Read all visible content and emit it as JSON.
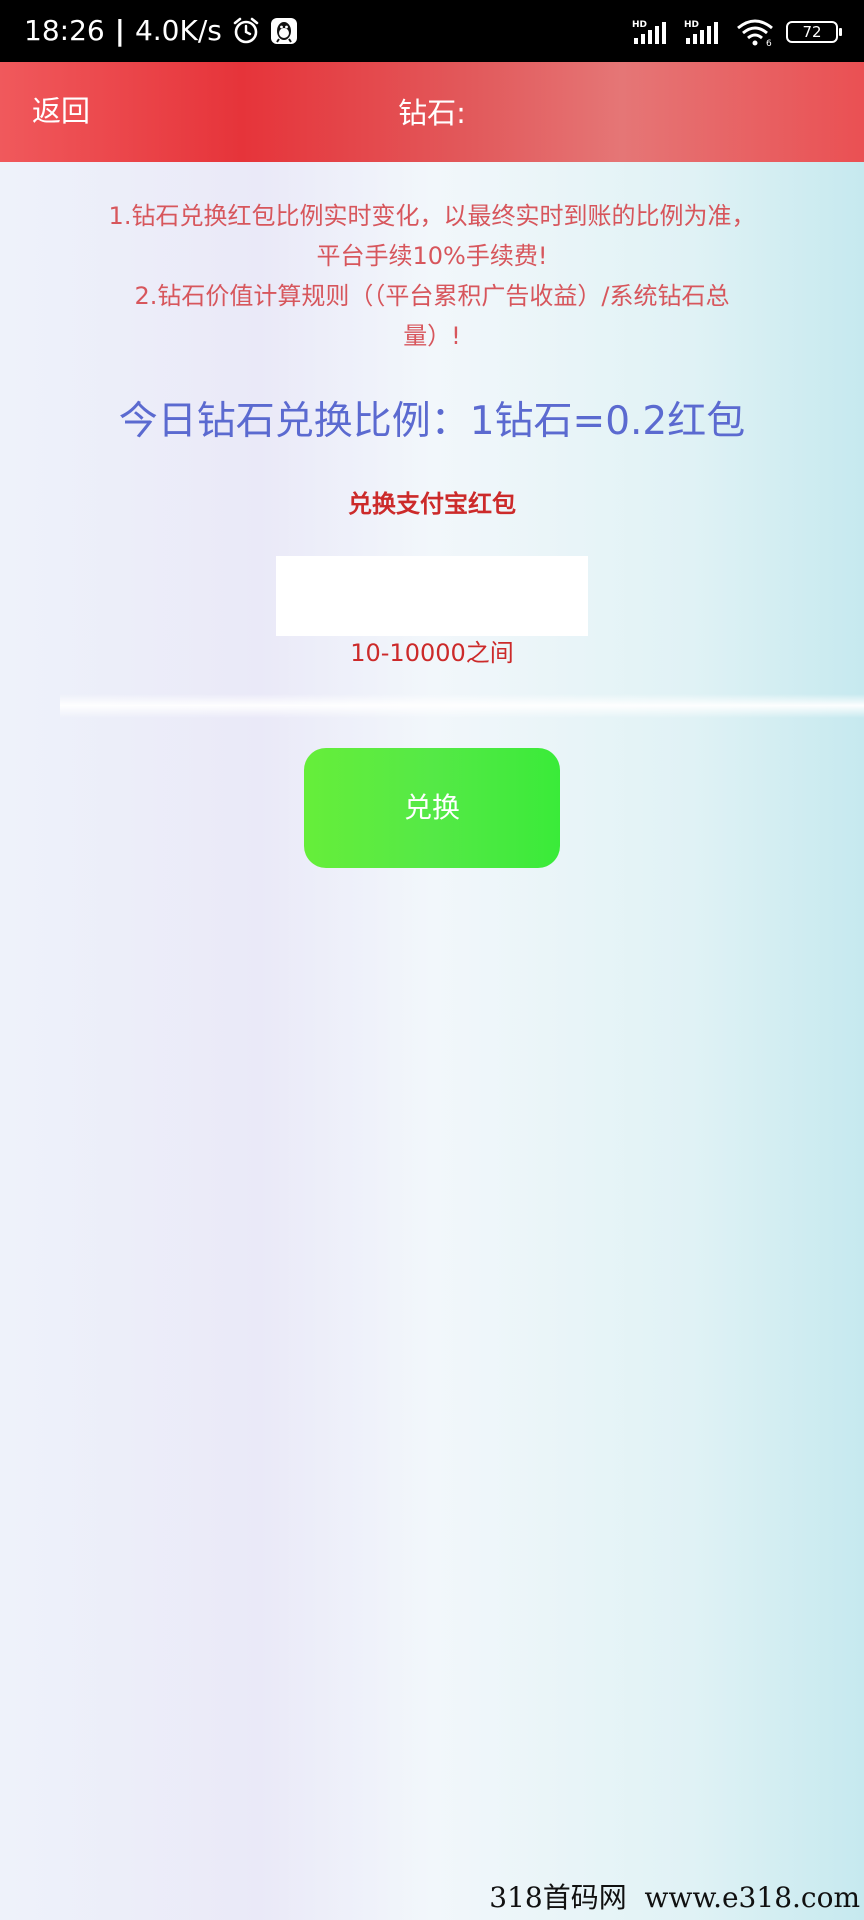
{
  "status_bar": {
    "time": "18:26",
    "separator": "|",
    "network_speed": "4.0K/s",
    "left_icons": [
      "alarm-icon",
      "qq-icon"
    ],
    "right_icons": [
      "hd-signal-icon",
      "hd-signal-icon",
      "wifi-icon"
    ],
    "signal_label_1": "HD",
    "signal_label_2": "HD",
    "wifi_label": "6",
    "battery": "72"
  },
  "nav": {
    "back_label": "返回",
    "title": "钻石:",
    "color": "#e6343a"
  },
  "notice": {
    "line1": "1.钻石兑换红包比例实时变化，以最终实时到账的比例为准，",
    "line2": "平台手续10%手续费!",
    "line3": "2.钻石价值计算规则（（平台累积广告收益）/系统钻石总",
    "line4": "量）!"
  },
  "rate_text": "今日钻石兑换比例：1钻石=0.2红包",
  "exchange_label": "兑换支付宝红包",
  "amount_input": {
    "value": "",
    "placeholder": ""
  },
  "range_hint": "10-10000之间",
  "exchange_button": {
    "label": "兑换",
    "color": "#55e946"
  },
  "watermark": "318首码网  www.e318.com"
}
